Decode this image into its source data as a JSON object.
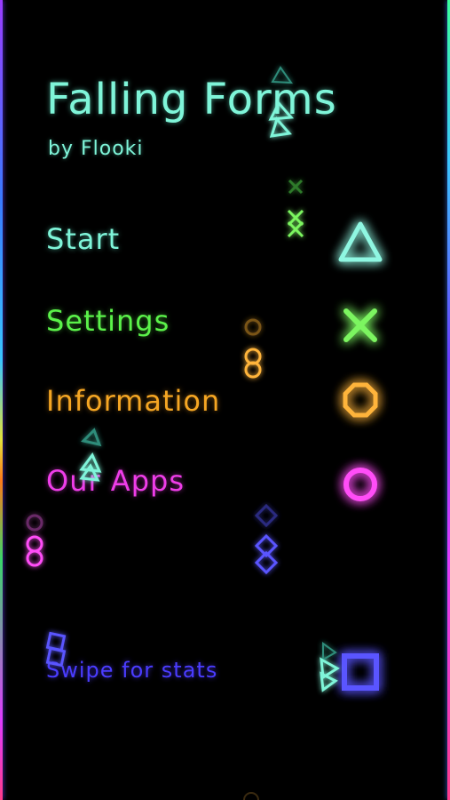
{
  "app": {
    "title": "Falling Forms",
    "subtitle": "by Flooki"
  },
  "menu": {
    "start": "Start",
    "settings": "Settings",
    "information": "Information",
    "our_apps": "Our Apps"
  },
  "hint": {
    "swipe": "Swipe for stats"
  },
  "colors": {
    "start": "#7ff5d9",
    "settings": "#5bf24a",
    "information": "#f5a623",
    "our_apps": "#ee3de8",
    "swipe": "#4a3cff"
  },
  "icons": {
    "start": "triangle-icon",
    "settings": "cross-icon",
    "information": "octagon-icon",
    "our_apps": "circle-icon",
    "swipe": "square-icon"
  }
}
